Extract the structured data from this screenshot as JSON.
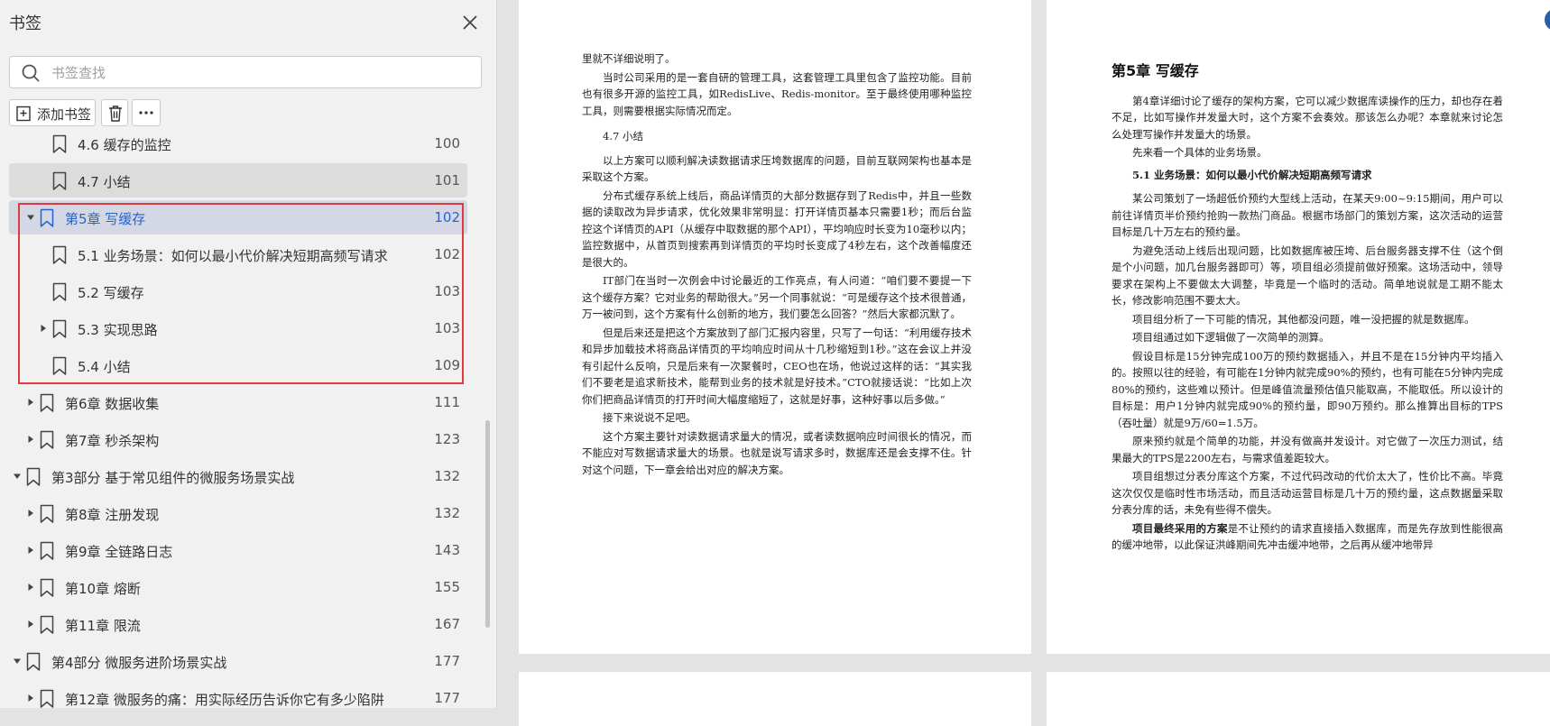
{
  "sidebar": {
    "title": "书签",
    "search_placeholder": "书签查找",
    "add_bookmark_label": "添加书签",
    "items": [
      {
        "label": "4.6 缓存的监控",
        "page": "100",
        "caret": "none"
      },
      {
        "label": "4.7 小结",
        "page": "101",
        "caret": "none"
      },
      {
        "label": "第5章 写缓存",
        "page": "102",
        "caret": "expanded"
      },
      {
        "label": "5.1 业务场景：如何以最小代价解决短期高频写请求",
        "page": "102",
        "caret": "none"
      },
      {
        "label": "5.2 写缓存",
        "page": "103",
        "caret": "none"
      },
      {
        "label": "5.3 实现思路",
        "page": "103",
        "caret": "collapsed"
      },
      {
        "label": "5.4 小结",
        "page": "109",
        "caret": "none"
      },
      {
        "label": "第6章 数据收集",
        "page": "111",
        "caret": "collapsed"
      },
      {
        "label": "第7章 秒杀架构",
        "page": "123",
        "caret": "collapsed"
      },
      {
        "label": "第3部分 基于常见组件的微服务场景实战",
        "page": "132",
        "caret": "expanded"
      },
      {
        "label": "第8章 注册发现",
        "page": "132",
        "caret": "collapsed"
      },
      {
        "label": "第9章 全链路日志",
        "page": "143",
        "caret": "collapsed"
      },
      {
        "label": "第10章 熔断",
        "page": "155",
        "caret": "collapsed"
      },
      {
        "label": "第11章 限流",
        "page": "167",
        "caret": "collapsed"
      },
      {
        "label": "第4部分 微服务进阶场景实战",
        "page": "177",
        "caret": "expanded"
      },
      {
        "label": "第12章 微服务的痛：用实际经历告诉你它有多少陷阱",
        "page": "177",
        "caret": "collapsed"
      }
    ]
  },
  "left_page": {
    "p0": "里就不详细说明了。",
    "p1": "当时公司采用的是一套自研的管理工具，这套管理工具里包含了监控功能。目前也有很多开源的监控工具，如RedisLive、Redis-monitor。至于最终使用哪种监控工具，则需要根据实际情况而定。",
    "sec": "4.7 小结",
    "p2": "以上方案可以顺利解决读数据请求压垮数据库的问题，目前互联网架构也基本是采取这个方案。",
    "p3": "分布式缓存系统上线后，商品详情页的大部分数据存到了Redis中，并且一些数据的读取改为异步请求，优化效果非常明显：打开详情页基本只需要1秒；而后台监控这个详情页的API（从缓存中取数据的那个API），平均响应时长变为10毫秒以内；监控数据中，从首页到搜索再到详情页的平均时长变成了4秒左右，这个改善幅度还是很大的。",
    "p4": "IT部门在当时一次例会中讨论最近的工作亮点，有人问道：“咱们要不要提一下这个缓存方案？它对业务的帮助很大。”另一个同事就说：“可是缓存这个技术很普通，万一被问到，这个方案有什么创新的地方，我们要怎么回答？”然后大家都沉默了。",
    "p5": "但是后来还是把这个方案放到了部门汇报内容里，只写了一句话：“利用缓存技术和异步加载技术将商品详情页的平均响应时间从十几秒缩短到1秒。”这在会议上并没有引起什么反响，只是后来有一次聚餐时，CEO也在场，他说过这样的话：“其实我们不要老是追求新技术，能帮到业务的技术就是好技术。”CTO就接话说：“比如上次你们把商品详情页的打开时间大幅度缩短了，这就是好事，这种好事以后多做。”",
    "p6": "接下来说说不足吧。",
    "p7": "这个方案主要针对读数据请求量大的情况，或者读数据响应时间很长的情况，而不能应对写数据请求量大的场景。也就是说写请求多时，数据库还是会支撑不住。针对这个问题，下一章会给出对应的解决方案。"
  },
  "right_page": {
    "chapter": "第5章  写缓存",
    "p1": "第4章详细讨论了缓存的架构方案，它可以减少数据库读操作的压力，却也存在着不足，比如写操作并发量大时，这个方案不会奏效。那该怎么办呢？本章就来讨论怎么处理写操作并发量大的场景。",
    "p2": "先来看一个具体的业务场景。",
    "sec": "5.1  业务场景：如何以最小代价解决短期高频写请求",
    "p3": "某公司策划了一场超低价预约大型线上活动，在某天9:00~9:15期间，用户可以前往详情页半价预约抢购一款热门商品。根据市场部门的策划方案，这次活动的运营目标是几十万左右的预约量。",
    "p4": "为避免活动上线后出现问题，比如数据库被压垮、后台服务器支撑不住（这个倒是个小问题，加几台服务器即可）等，项目组必须提前做好预案。这场活动中，领导要求在架构上不要做太大调整，毕竟是一个临时的活动。简单地说就是工期不能太长，修改影响范围不要太大。",
    "p5": "项目组分析了一下可能的情况，其他都没问题，唯一没把握的就是数据库。",
    "p6": "项目组通过如下逻辑做了一次简单的测算。",
    "p7": "假设目标是15分钟完成100万的预约数据插入，并且不是在15分钟内平均插入的。按照以往的经验，有可能在1分钟内就完成90%的预约，也有可能在5分钟内完成80%的预约，这些难以预计。但是峰值流量预估值只能取高，不能取低。所以设计的目标是：用户1分钟内就完成90%的预约量，即90万预约。那么推算出目标的TPS（吞吐量）就是9万/60=1.5万。",
    "p8": "原来预约就是个简单的功能，并没有做高并发设计。对它做了一次压力测试，结果最大的TPS是2200左右，与需求值差距较大。",
    "p9": "项目组想过分表分库这个方案，不过代码改动的代价太大了，性价比不高。毕竟这次仅仅是临时性市场活动，而且活动运营目标是几十万的预约量，这点数据量采取分表分库的话，未免有些得不偿失。",
    "p10_bold": "项目最终采用的方案",
    "p10_rest": "是不让预约的请求直接插入数据库，而是先存放到性能很高的缓冲地带，以此保证洪峰期间先冲击缓冲地带，之后再从缓冲地带异"
  }
}
